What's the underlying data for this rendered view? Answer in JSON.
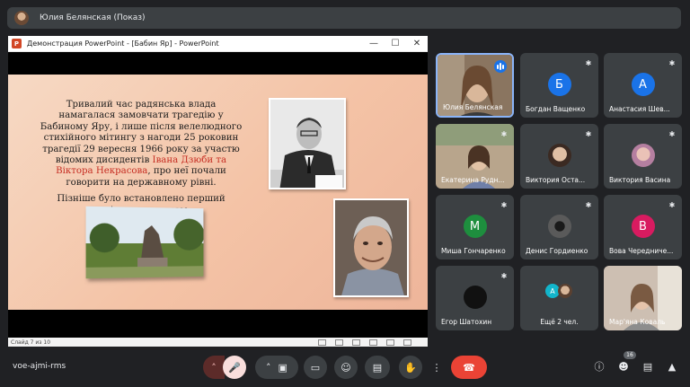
{
  "presenter_bar": {
    "title": "Юлия Белянская (Показ)"
  },
  "ppt": {
    "window_title": "Демонстрация PowerPoint - [Бабин Яр] - PowerPoint",
    "status": "Слайд 7 из 10",
    "slide": {
      "text1_a": "Тривалий час радянська влада намагалася замовчати трагедію у Бабиному Яру, і лише після велелюдного стихійного мітингу з нагоди 25 роковин трагедії 29 вересня 1966 року за участю відомих дисидентів ",
      "text1_red": "Івана Дзюби  та Віктора Некрасова",
      "text1_b": ", про неї почали говорити на державному рівні.",
      "text2": "Пізніше було встановлено перший пам'ятник жертвам."
    }
  },
  "participants": [
    {
      "name": "Юлия Белянская",
      "type": "video",
      "speaking": true
    },
    {
      "name": "Богдан Ващенко",
      "type": "letter",
      "letter": "Б",
      "color": "#1a73e8"
    },
    {
      "name": "Анастасия Шев...",
      "type": "letter",
      "letter": "А",
      "color": "#1a73e8"
    },
    {
      "name": "Екатерина Рудн...",
      "type": "video"
    },
    {
      "name": "Виктория Оста...",
      "type": "photo"
    },
    {
      "name": "Виктория Васина",
      "type": "photo"
    },
    {
      "name": "Миша Гончаренко",
      "type": "letter",
      "letter": "М",
      "color": "#1e8e3e"
    },
    {
      "name": "Денис Гордиенко",
      "type": "photo"
    },
    {
      "name": "Вова Чередниче...",
      "type": "letter",
      "letter": "В",
      "color": "#d81b60"
    },
    {
      "name": "Егор Шатохин",
      "type": "photo"
    },
    {
      "name": "Ещё 2 чел.",
      "type": "group"
    },
    {
      "name": "Мар'яна Коваль",
      "type": "video"
    }
  ],
  "bottom": {
    "meeting_code": "voe-ajmi-rms",
    "people_count": "16"
  },
  "colors": {
    "background": "#202124",
    "tile": "#3c4043",
    "end_call": "#ea4335"
  }
}
